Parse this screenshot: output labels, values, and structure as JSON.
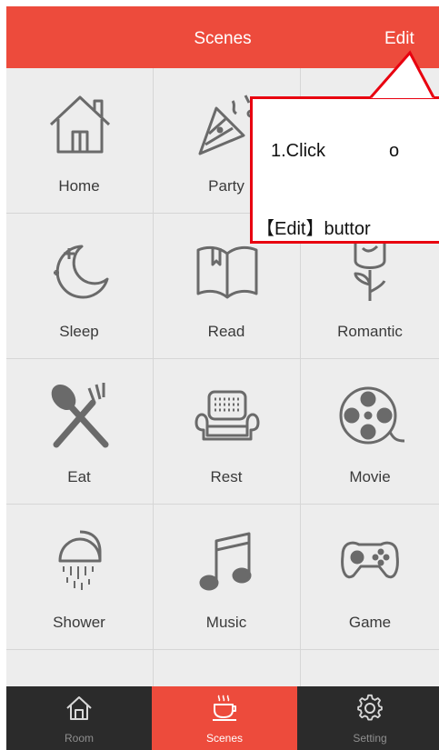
{
  "header": {
    "title": "Scenes",
    "edit_label": "Edit"
  },
  "scenes": [
    {
      "label": "Home",
      "icon": "house-icon"
    },
    {
      "label": "Party",
      "icon": "party-popper-icon"
    },
    {
      "label": "",
      "icon": ""
    },
    {
      "label": "Sleep",
      "icon": "moon-icon"
    },
    {
      "label": "Read",
      "icon": "book-icon"
    },
    {
      "label": "Romantic",
      "icon": "rose-icon"
    },
    {
      "label": "Eat",
      "icon": "cutlery-icon"
    },
    {
      "label": "Rest",
      "icon": "sofa-icon"
    },
    {
      "label": "Movie",
      "icon": "film-reel-icon"
    },
    {
      "label": "Shower",
      "icon": "shower-icon"
    },
    {
      "label": "Music",
      "icon": "music-note-icon"
    },
    {
      "label": "Game",
      "icon": "gamepad-icon"
    }
  ],
  "tabs": [
    {
      "label": "Room",
      "icon": "house-icon"
    },
    {
      "label": "Scenes",
      "icon": "coffee-cup-icon",
      "active": true
    },
    {
      "label": "Setting",
      "icon": "gear-icon"
    }
  ],
  "callout": {
    "step_text": "1.Click",
    "step_text2": "o",
    "button_text": "【Edit】buttor"
  },
  "colors": {
    "accent": "#ed4b3c",
    "tabbar": "#2b2b2b",
    "grid_bg": "#ededed",
    "callout_border": "#e8000f"
  }
}
